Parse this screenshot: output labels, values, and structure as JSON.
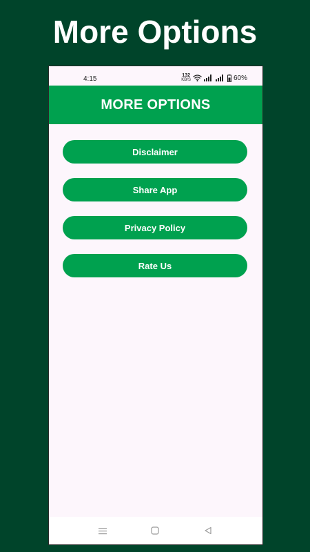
{
  "promo": {
    "title": "More Options"
  },
  "status_bar": {
    "time": "4:15",
    "net_speed_value": "132",
    "net_speed_unit": "KB/S",
    "battery": "60%"
  },
  "app_bar": {
    "title": "MORE OPTIONS",
    "color": "#00a14f"
  },
  "menu": {
    "items": [
      {
        "label": "Disclaimer"
      },
      {
        "label": "Share App"
      },
      {
        "label": "Privacy Policy"
      },
      {
        "label": "Rate Us"
      }
    ]
  },
  "nav_bar": {
    "icons": [
      "menu-icon",
      "home-icon",
      "back-icon"
    ]
  },
  "colors": {
    "background": "#00442a",
    "accent": "#00a14f",
    "screen": "#fdf6fc"
  }
}
